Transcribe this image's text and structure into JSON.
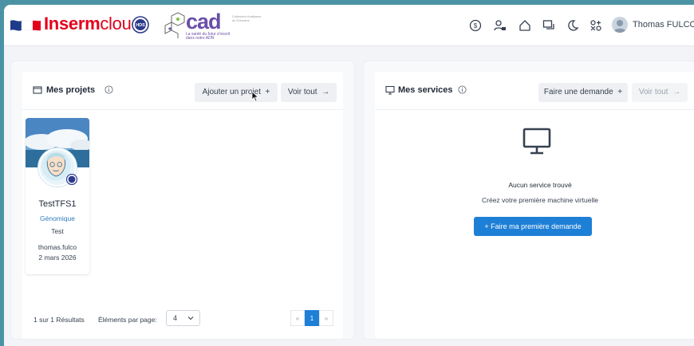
{
  "header": {
    "brand_bold": "Inserm",
    "brand_light": "cloud",
    "hds_label": "HDS",
    "cad_logo": "cad",
    "cad_tagline_1": "La santé du futur s'inscrit",
    "cad_tagline_2": "dans notre ADN",
    "cad_side_text": "Collecteur Analyseur de Données",
    "user_name": "Thomas FULCONIS",
    "icons": [
      "dollar-icon",
      "user-lock-icon",
      "home-icon",
      "chat-icon",
      "moon-icon",
      "apps-icon"
    ]
  },
  "projects_panel": {
    "title": "Mes projets",
    "add_button": "Ajouter un projet",
    "add_symbol": "+",
    "view_all_button": "Voir tout",
    "view_all_symbol": "→",
    "projects": [
      {
        "name": "TestTFS1",
        "domain": "Génomique",
        "description": "Test",
        "owner": "thomas.fulco",
        "date": "2 mars 2026"
      }
    ],
    "pagination": {
      "result_text": "1 sur 1 Résultats",
      "per_page_label": "Éléments par page:",
      "per_page_value": "4",
      "prev": "«",
      "current_page": "1",
      "next": "»"
    }
  },
  "services_panel": {
    "title": "Mes services",
    "request_button": "Faire une demande",
    "request_symbol": "+",
    "view_all_button": "Voir tout",
    "view_all_symbol": "→",
    "empty_title": "Aucun service trouvé",
    "empty_subtitle": "Créez votre première machine virtuelle",
    "primary_button": "+ Faire ma première demande"
  },
  "colors": {
    "brand_red": "#e3001b",
    "cad_purple": "#6b4ea8",
    "primary_blue": "#1e7fd6",
    "background_teal": "#4b93a4"
  }
}
